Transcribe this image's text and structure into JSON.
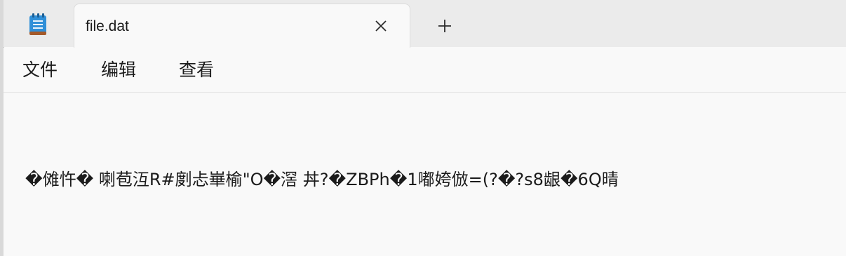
{
  "window": {
    "tab_title": "file.dat",
    "app_icon": "notepad-icon",
    "close_icon": "close-icon",
    "new_tab_icon": "plus-icon"
  },
  "menu": {
    "file": "文件",
    "edit": "编辑",
    "view": "查看"
  },
  "editor": {
    "content": "�傩忤� 喇苞沍R#剫忐崋榆\"O�滘 丼?�ZBPh�1嘟姱倣=(?�?s8龈�6Q晴"
  },
  "colors": {
    "titlebar_bg": "#ebebeb",
    "content_bg": "#f9f9f9",
    "text": "#1b1b1b"
  }
}
